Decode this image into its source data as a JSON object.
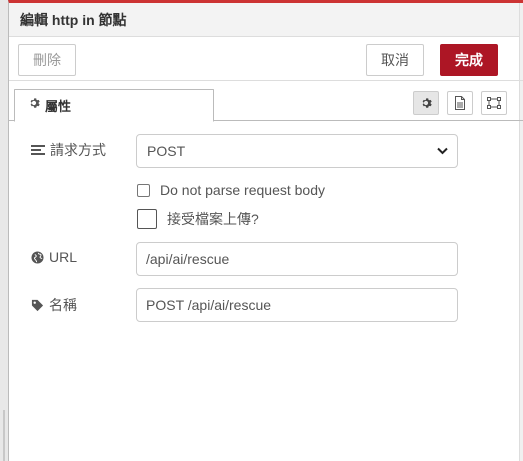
{
  "header": {
    "title": "編輯 http in 節點"
  },
  "toolbar": {
    "delete_label": "刪除",
    "cancel_label": "取消",
    "done_label": "完成"
  },
  "tabs": [
    {
      "label": "屬性",
      "icon": "gear-icon"
    }
  ],
  "tab_tools": [
    "gear-icon",
    "document-icon",
    "frame-icon"
  ],
  "form": {
    "method": {
      "label": "請求方式",
      "icon": "list-icon",
      "value": "POST"
    },
    "no_parse": {
      "label": "Do not parse request body",
      "checked": false
    },
    "upload": {
      "label": "接受檔案上傳?",
      "checked": false
    },
    "url": {
      "label": "URL",
      "icon": "globe-icon",
      "value": "/api/ai/rescue"
    },
    "name": {
      "label": "名稱",
      "icon": "tag-icon",
      "value": "POST /api/ai/rescue"
    }
  },
  "colors": {
    "accent": "#ad1625",
    "header_top": "#cc3333"
  }
}
